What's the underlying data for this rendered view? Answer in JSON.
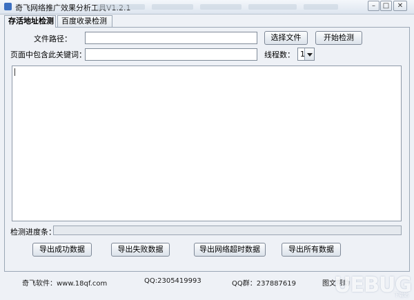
{
  "window": {
    "title": "奇飞网络推广效果分析工具V1.2.1",
    "controls": {
      "minimize": "–",
      "maximize": "□",
      "close": "✕"
    }
  },
  "tabs": [
    {
      "label": "存活地址检测",
      "active": true
    },
    {
      "label": "百度收录检测",
      "active": false
    }
  ],
  "form": {
    "file_path_label": "文件路径：",
    "file_path_value": "",
    "select_file_button": "选择文件",
    "start_check_button": "开始检测",
    "keyword_label": "页面中包含此关键词：",
    "keyword_value": "",
    "threads_label": "线程数：",
    "threads_value": "1"
  },
  "log": {
    "content": ""
  },
  "progress": {
    "label": "检测进度条：",
    "value_percent": 0
  },
  "export_buttons": {
    "success": "导出成功数据",
    "failed": "导出失败数据",
    "timeout": "导出网络超时数据",
    "all": "导出所有数据"
  },
  "footer": {
    "software": "奇飞软件：www.18qf.com",
    "qq": "QQ:2305419993",
    "qq_group": "QQ群：237887619",
    "help": "图文帮助"
  },
  "watermark": {
    "text": "UEBUG",
    "sub": "下载站"
  },
  "colors": {
    "window_bg": "#eef1f6",
    "progress_fill": "#5b8ed8"
  }
}
